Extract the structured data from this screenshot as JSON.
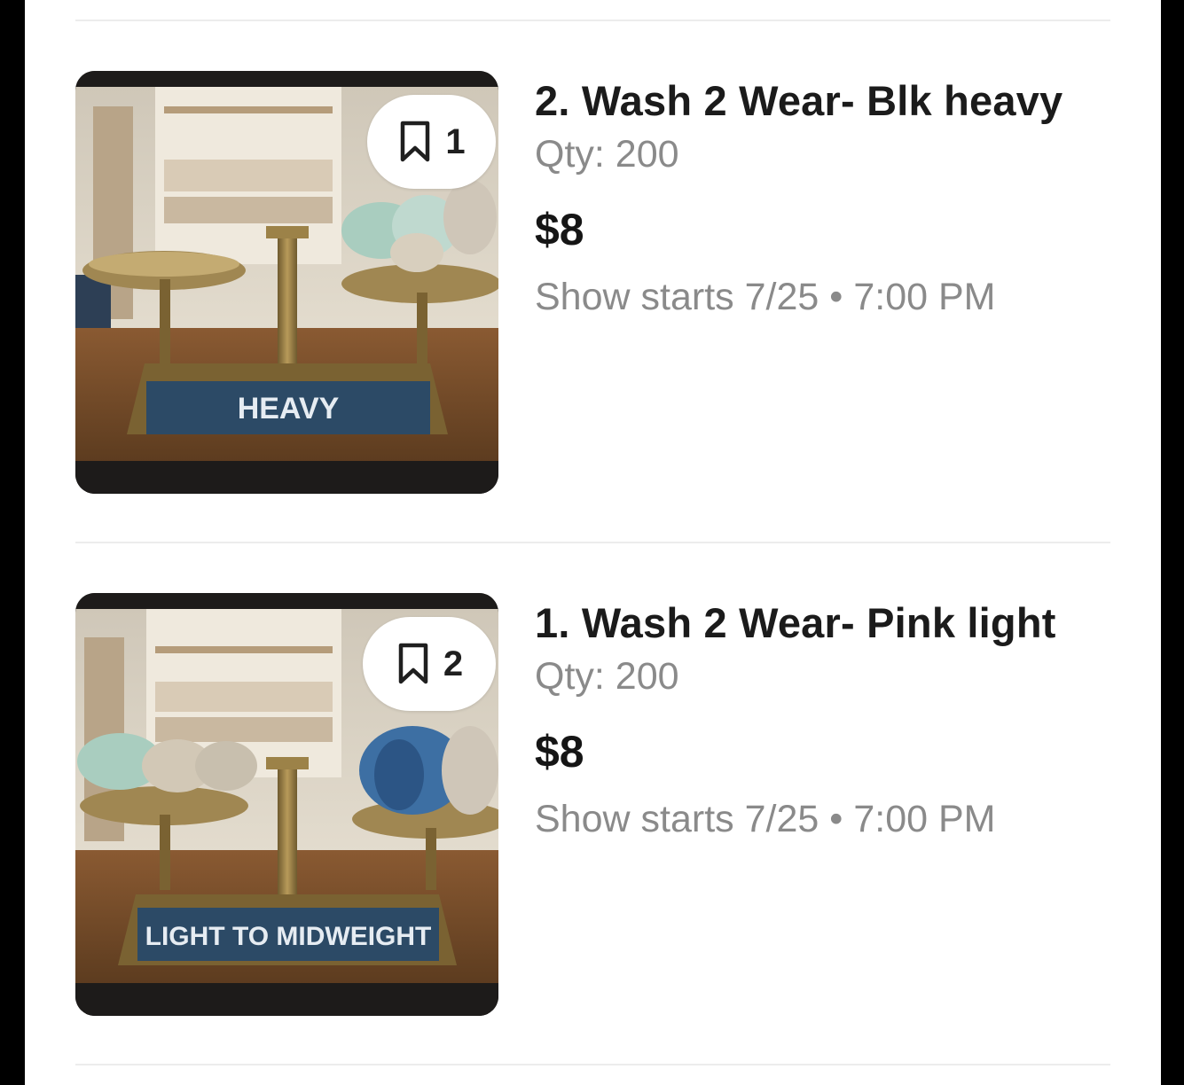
{
  "listings": [
    {
      "title": "2. Wash 2 Wear- Blk heavy",
      "qty": "Qty: 200",
      "price": "$8",
      "show_label": "Show starts 7/25",
      "separator": "•",
      "show_time": "7:00 PM",
      "bookmark_count": "1",
      "bookmark_icon": "bookmark-icon",
      "image_sign": "HEAVY"
    },
    {
      "title": "1. Wash 2 Wear- Pink light",
      "qty": "Qty: 200",
      "price": "$8",
      "show_label": "Show starts 7/25",
      "separator": "•",
      "show_time": "7:00 PM",
      "bookmark_count": "2",
      "bookmark_icon": "bookmark-icon",
      "image_sign": "LIGHT TO MIDWEIGHT"
    }
  ],
  "colors": {
    "title": "#1b1b1b",
    "secondary": "#8a8a8a",
    "divider": "#ececec",
    "sign_blue": "#2c4a66"
  }
}
